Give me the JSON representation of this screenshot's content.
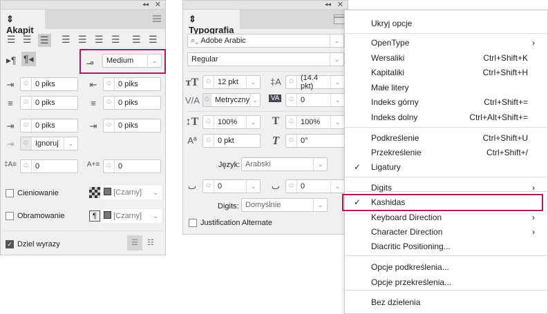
{
  "akapit": {
    "title": "Akapit",
    "hyphenation_mode": "Medium",
    "left_indent": "0 piks",
    "right_indent": "0 piks",
    "first_line_indent": "0 piks",
    "last_line_indent": "0 piks",
    "space_before": "0 piks",
    "space_after": "0 piks",
    "align_to_grid": "Ignoruj",
    "drop_cap_lines": "0",
    "drop_cap_chars": "0",
    "shading_label": "Cieniowanie",
    "shading_color": "[Czarny]",
    "border_label": "Obramowanie",
    "border_color": "[Czarny]",
    "hyphenate_label": "Dziel wyrazy"
  },
  "typografia": {
    "title": "Typografia",
    "font_family": "Adobe Arabic",
    "font_style": "Regular",
    "font_size": "12 pkt",
    "leading": "(14.4 pkt)",
    "kerning": "Metryczny",
    "tracking": "0",
    "vertical_scale": "100%",
    "horizontal_scale": "100%",
    "baseline_shift": "0 pkt",
    "skew": "0°",
    "language_label": "Język:",
    "language": "Arabski",
    "diacritic_x": "0",
    "diacritic_y": "0",
    "digits_label": "Digits:",
    "digits": "Domyślnie",
    "justification_alternate": "Justification Alternate"
  },
  "menu": {
    "items": [
      {
        "label": "Ukryj opcje"
      },
      {
        "label": "OpenType",
        "submenu": true
      },
      {
        "label": "Wersaliki",
        "shortcut": "Ctrl+Shift+K"
      },
      {
        "label": "Kapitaliki",
        "shortcut": "Ctrl+Shift+H"
      },
      {
        "label": "Małe litery"
      },
      {
        "label": "Indeks górny",
        "shortcut": "Ctrl+Shift+="
      },
      {
        "label": "Indeks dolny",
        "shortcut": "Ctrl+Alt+Shift+="
      },
      {
        "label": "Podkreślenie",
        "shortcut": "Ctrl+Shift+U"
      },
      {
        "label": "Przekreślenie",
        "shortcut": "Ctrl+Shift+/"
      },
      {
        "label": "Ligatury",
        "checked": true
      },
      {
        "label": "Digits",
        "submenu": true
      },
      {
        "label": "Kashidas",
        "checked": true
      },
      {
        "label": "Keyboard Direction",
        "submenu": true
      },
      {
        "label": "Character Direction",
        "submenu": true
      },
      {
        "label": "Diacritic Positioning..."
      },
      {
        "label": "Opcje podkreślenia..."
      },
      {
        "label": "Opcje przekreślenia..."
      },
      {
        "label": "Bez dzielenia"
      }
    ]
  },
  "colors": {
    "highlight": "#b0195e"
  }
}
